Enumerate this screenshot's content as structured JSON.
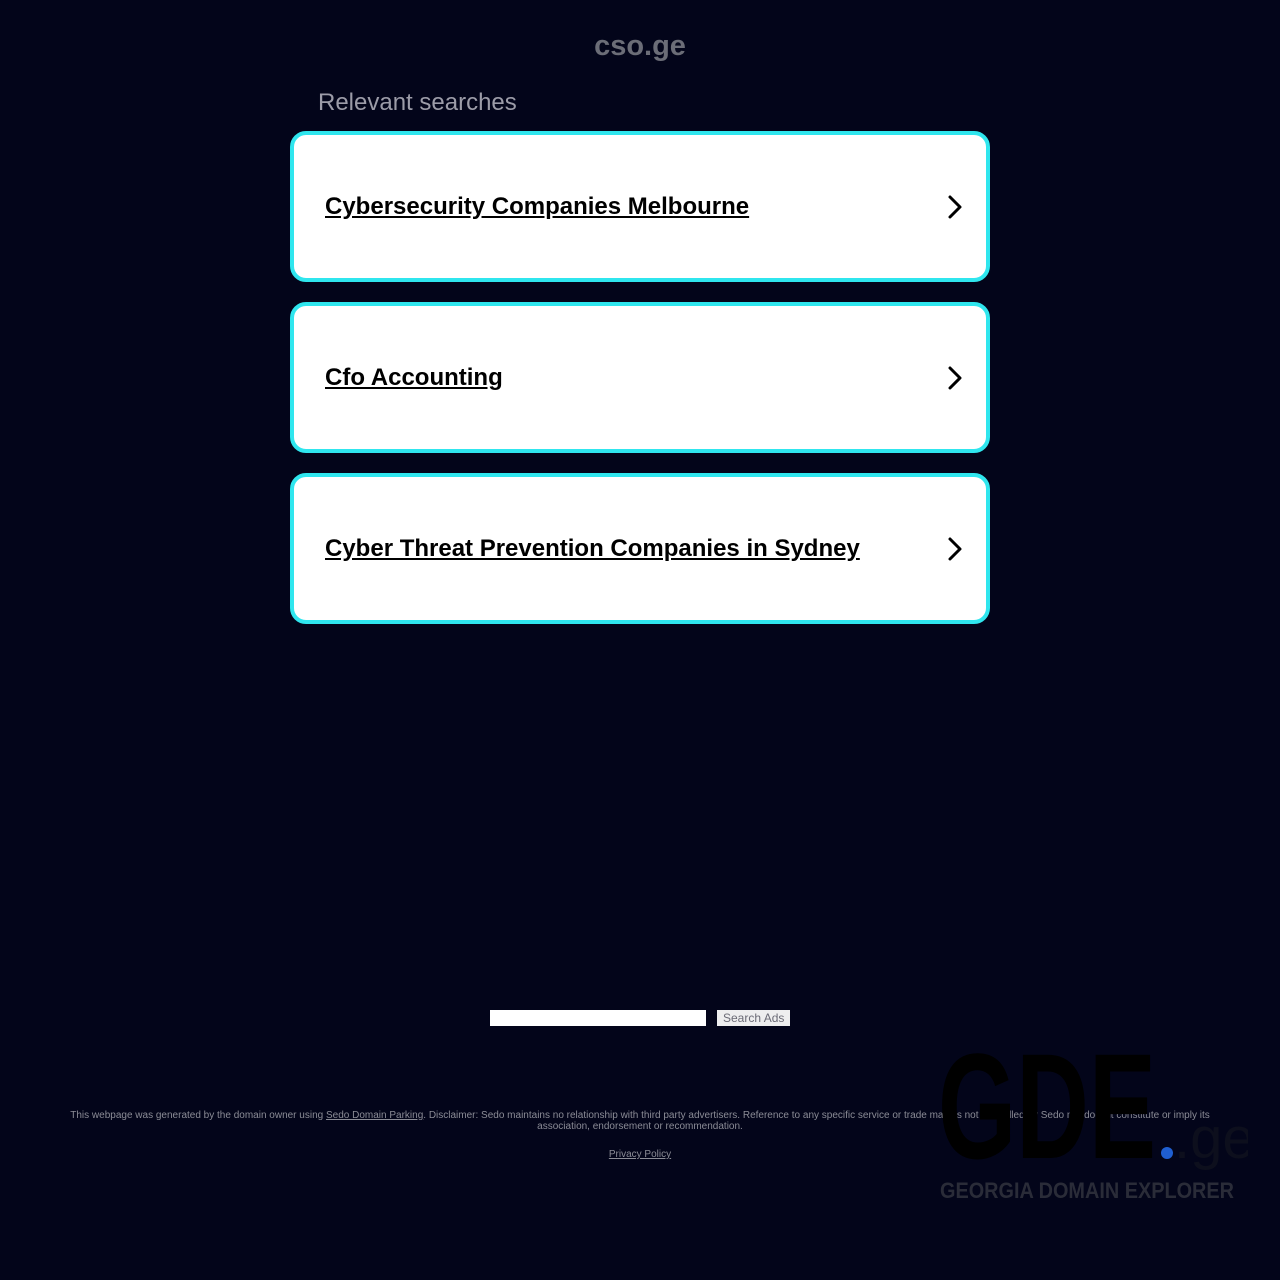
{
  "header": {
    "domain": "cso.ge",
    "section_title": "Relevant searches"
  },
  "searches": [
    {
      "label": "Cybersecurity Companies Melbourne"
    },
    {
      "label": "Cfo Accounting"
    },
    {
      "label": "Cyber Threat Prevention Companies in Sydney"
    }
  ],
  "search_ads": {
    "input_value": "",
    "button_label": "Search Ads"
  },
  "footer": {
    "text_before_link": "This webpage was generated by the domain owner using ",
    "link_label": "Sedo Domain Parking",
    "text_after_link": ". Disclaimer: Sedo maintains no relationship with third party advertisers. Reference to any specific service or trade mark is not controlled by Sedo nor does it constitute or imply its association, endorsement or recommendation.",
    "privacy_label": "Privacy Policy"
  },
  "watermark": {
    "logo_text": "GDE",
    "logo_suffix": ".ge",
    "tagline": "GEORGIA DOMAIN EXPLORER",
    "accent_color": "#1f5fd1"
  },
  "colors": {
    "background": "#03051a",
    "card_border": "#2fe6ee"
  },
  "icons": {
    "card_arrow": "chevron-right-icon"
  }
}
